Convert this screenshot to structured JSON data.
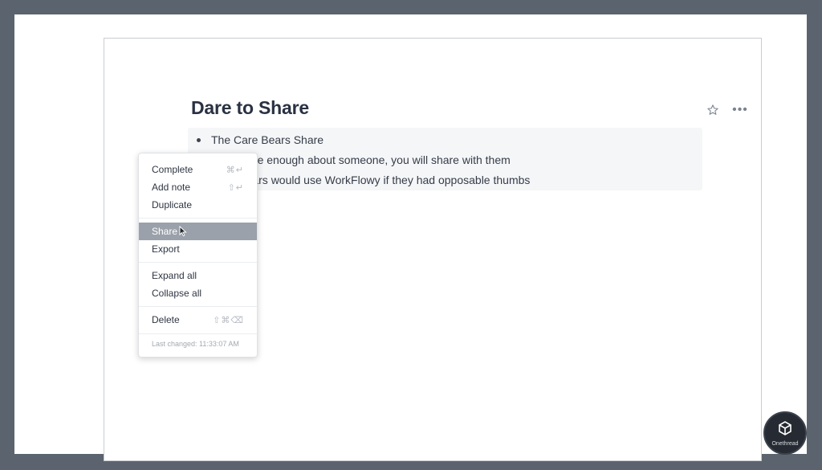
{
  "document": {
    "title": "Dare to Share",
    "bullets": [
      "The Care Bears Share",
      "If you care enough about someone, you will share with them",
      "Care Bears would use WorkFlowy if they had opposable thumbs"
    ]
  },
  "toolbar": {
    "star_icon": "star-outline-icon",
    "more_label": "•••"
  },
  "context_menu": {
    "items": [
      {
        "label": "Complete",
        "shortcut": "⌘↵"
      },
      {
        "label": "Add note",
        "shortcut": "⇧↵"
      },
      {
        "label": "Duplicate",
        "shortcut": ""
      },
      {
        "label": "Share",
        "shortcut": "",
        "active": true
      },
      {
        "label": "Export",
        "shortcut": ""
      },
      {
        "label": "Expand all",
        "shortcut": ""
      },
      {
        "label": "Collapse all",
        "shortcut": ""
      },
      {
        "label": "Delete",
        "shortcut": "⇧⌘⌫"
      }
    ],
    "footer": "Last changed: 11:33:07 AM"
  },
  "watermark": {
    "brand": "Onethread"
  },
  "colors": {
    "background": "#5b646e",
    "title": "#2a3142",
    "menu_highlight": "#9aa1aa",
    "brand_badge": "#262b33"
  }
}
